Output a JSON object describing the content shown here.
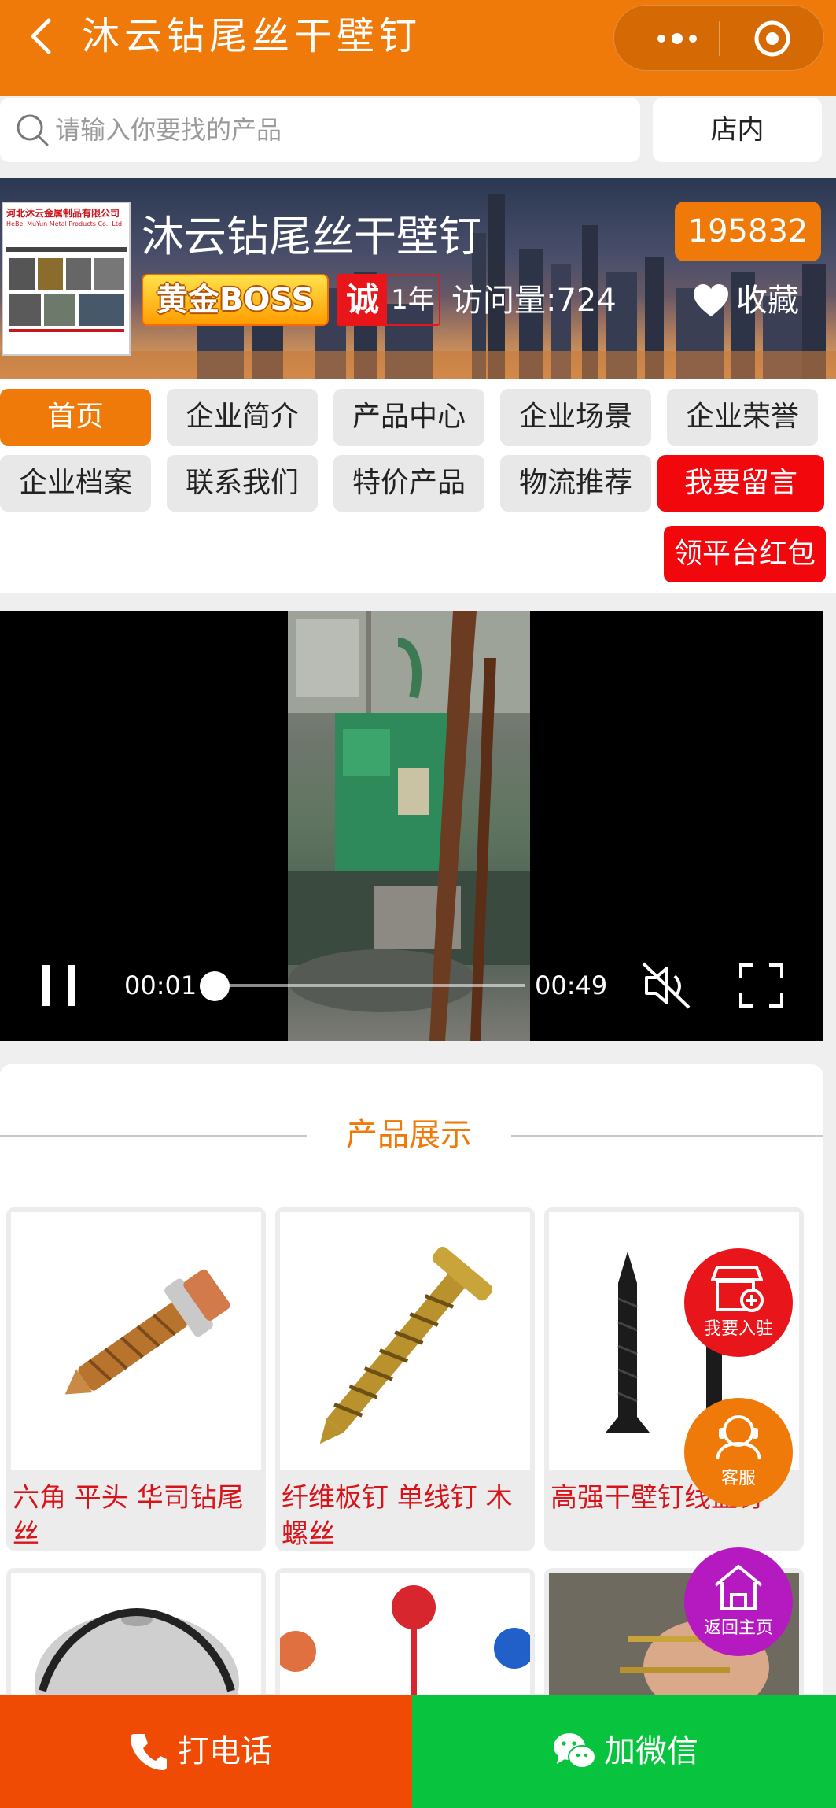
{
  "topbar": {
    "title": "沐云钻尾丝干壁钉",
    "bg": "#ef7a09"
  },
  "search": {
    "placeholder": "请输入你要找的产品",
    "store_button": "店内"
  },
  "banner": {
    "logo_title": "河北沐云金属制品有限公司",
    "logo_subtitle": "HeBei MuYun Metal Products Co., Ltd.",
    "store_name": "沐云钻尾丝干壁钉",
    "store_id": "195832",
    "badge_boss": "黄金BOSS",
    "badge_cheng": "诚",
    "badge_years": "1年",
    "visits": "访问量:724",
    "favorite": "收藏"
  },
  "nav": {
    "row1": [
      "首页",
      "企业简介",
      "产品中心",
      "企业场景",
      "企业荣誉"
    ],
    "row2": [
      "企业档案",
      "联系我们",
      "特价产品",
      "物流推荐",
      "我要留言"
    ],
    "red_packet": "领平台红包"
  },
  "video": {
    "current_time": "00:01",
    "duration": "00:49",
    "progress": 0.02,
    "muted": true
  },
  "products": {
    "section_title": "产品展示",
    "items": [
      {
        "name": "六角 平头 华司钻尾丝"
      },
      {
        "name": "纤维板钉 单线钉 木螺丝"
      },
      {
        "name": "高强干壁钉线盘钉"
      }
    ]
  },
  "floating": {
    "join": "我要入驻",
    "service": "客服",
    "home": "返回主页"
  },
  "bottom": {
    "call": "打电话",
    "wechat": "加微信"
  },
  "colors": {
    "accent": "#ef7a09",
    "red": "#f2070d",
    "call": "#f04b05",
    "wechat": "#08c33d"
  }
}
